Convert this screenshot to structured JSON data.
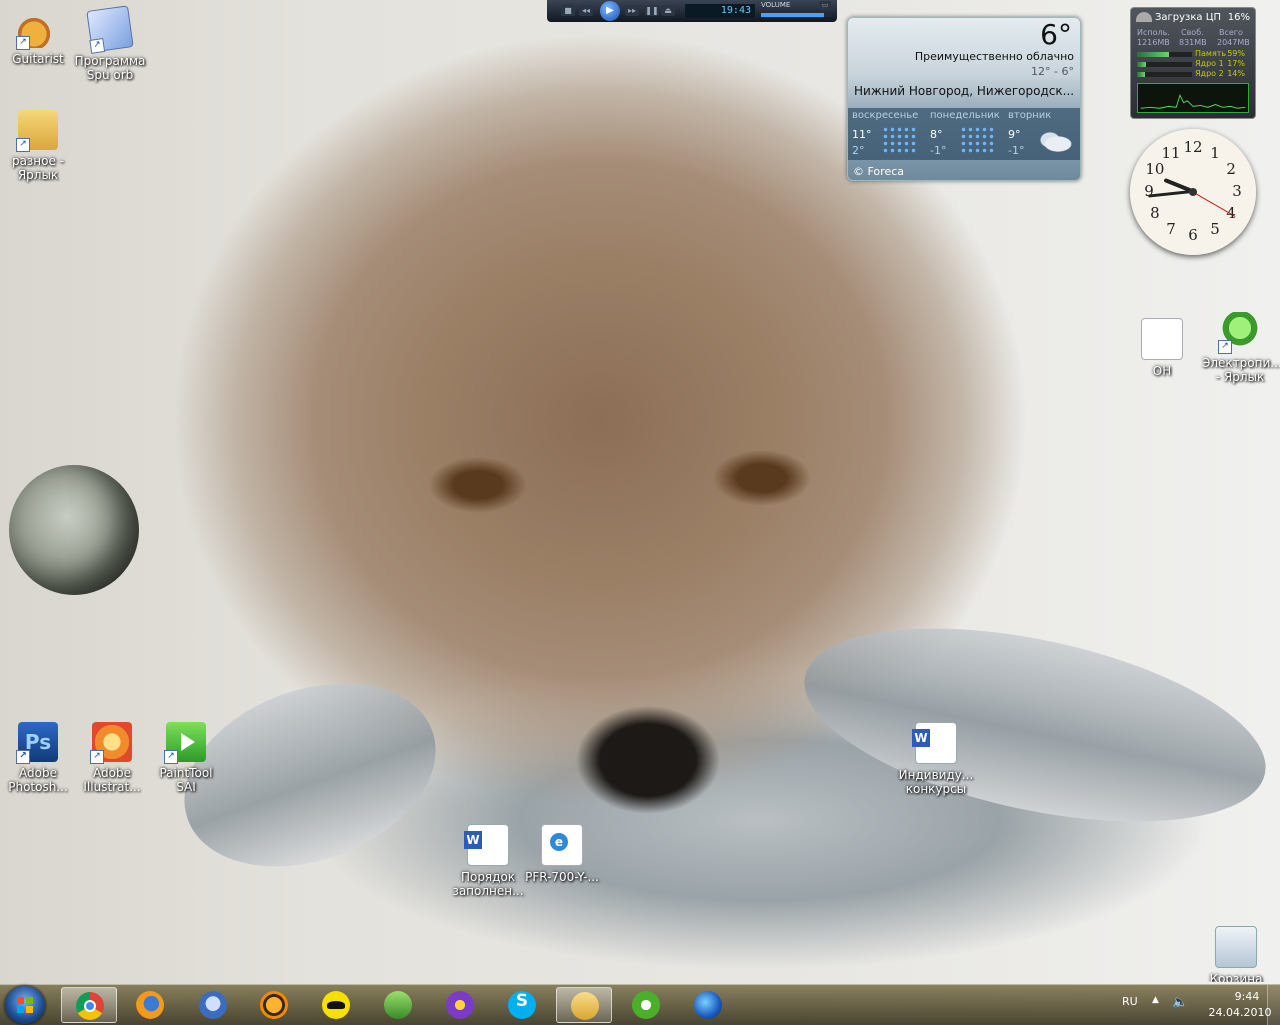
{
  "desktop": {
    "icons_left": [
      {
        "label": "Guitarist"
      },
      {
        "label": "Программа Spu orb"
      },
      {
        "label": "разное - Ярлык"
      },
      {
        "label": "Adobe Photosh..."
      },
      {
        "label": "Adobe Illustrat..."
      },
      {
        "label": "PaintTool SAI"
      }
    ],
    "icons_center": [
      {
        "label": "Порядок заполнен..."
      },
      {
        "label": "PFR-700-Y-..."
      },
      {
        "label": "Индивиду... конкурсы"
      }
    ],
    "icons_right": [
      {
        "label": "ОН"
      },
      {
        "label": "Электропи... - Ярлык"
      },
      {
        "label": "Корзина"
      }
    ],
    "shortcut_arrow": "↗"
  },
  "media_player": {
    "time": "19:43",
    "volume_label": "VOLUME",
    "volume_level": 0.9,
    "play_glyph": "▶",
    "prev_glyph": "◂◂",
    "next_glyph": "▸▸",
    "stop_glyph": "■",
    "pause_glyph": "❚❚",
    "eject_glyph": "⏏",
    "resize_glyph": "▭"
  },
  "weather": {
    "temperature": "6°",
    "condition": "Преимущественно облачно",
    "range": "12° - 6°",
    "city": "Нижний Новгород, Нижегородск...",
    "forecast": [
      {
        "day": "воскресенье",
        "high": "11°",
        "low": "2°",
        "icon": "rain-icon"
      },
      {
        "day": "понедельник",
        "high": "8°",
        "low": "-1°",
        "icon": "rain-icon"
      },
      {
        "day": "вторник",
        "high": "9°",
        "low": "-1°",
        "icon": "cloud-icon"
      }
    ],
    "credit": "© Foreca"
  },
  "cpu_meter": {
    "title": "Загрузка ЦП",
    "total_percent": "16%",
    "headers": [
      "Исполь.",
      "Своб.",
      "Всего"
    ],
    "values": [
      "1216MB",
      "831MB",
      "2047MB"
    ],
    "bars": [
      {
        "name": "Память",
        "value": "59%",
        "level": 0.59
      },
      {
        "name": "Ядро 1",
        "value": "17%",
        "level": 0.17
      },
      {
        "name": "Ядро 2",
        "value": "14%",
        "level": 0.14
      }
    ]
  },
  "clock": {
    "numbers": [
      "12",
      "1",
      "2",
      "3",
      "4",
      "5",
      "6",
      "7",
      "8",
      "9",
      "10",
      "11"
    ],
    "time": "9:44"
  },
  "taskbar": {
    "apps": [
      {
        "name": "Google Chrome",
        "icon": "chrome-icon",
        "active": true
      },
      {
        "name": "Firefox",
        "icon": "firefox-icon"
      },
      {
        "name": "Thunderbird",
        "icon": "thunderbird-icon"
      },
      {
        "name": "AIMP",
        "icon": "aimp-icon"
      },
      {
        "name": "Batman",
        "icon": "bat-icon"
      },
      {
        "name": "Drink",
        "icon": "drink-icon"
      },
      {
        "name": "Gear",
        "icon": "gear-icon"
      },
      {
        "name": "Skype",
        "icon": "skype-icon"
      },
      {
        "name": "Explorer",
        "icon": "explorer-icon",
        "active": true
      },
      {
        "name": "uTorrent",
        "icon": "utorrent-icon"
      },
      {
        "name": "Google Earth",
        "icon": "earth-icon"
      }
    ],
    "tray": {
      "language": "RU",
      "show_hidden_glyph": "▲",
      "speaker_glyph": "🔈",
      "time": "9:44",
      "date": "24.04.2010"
    }
  }
}
